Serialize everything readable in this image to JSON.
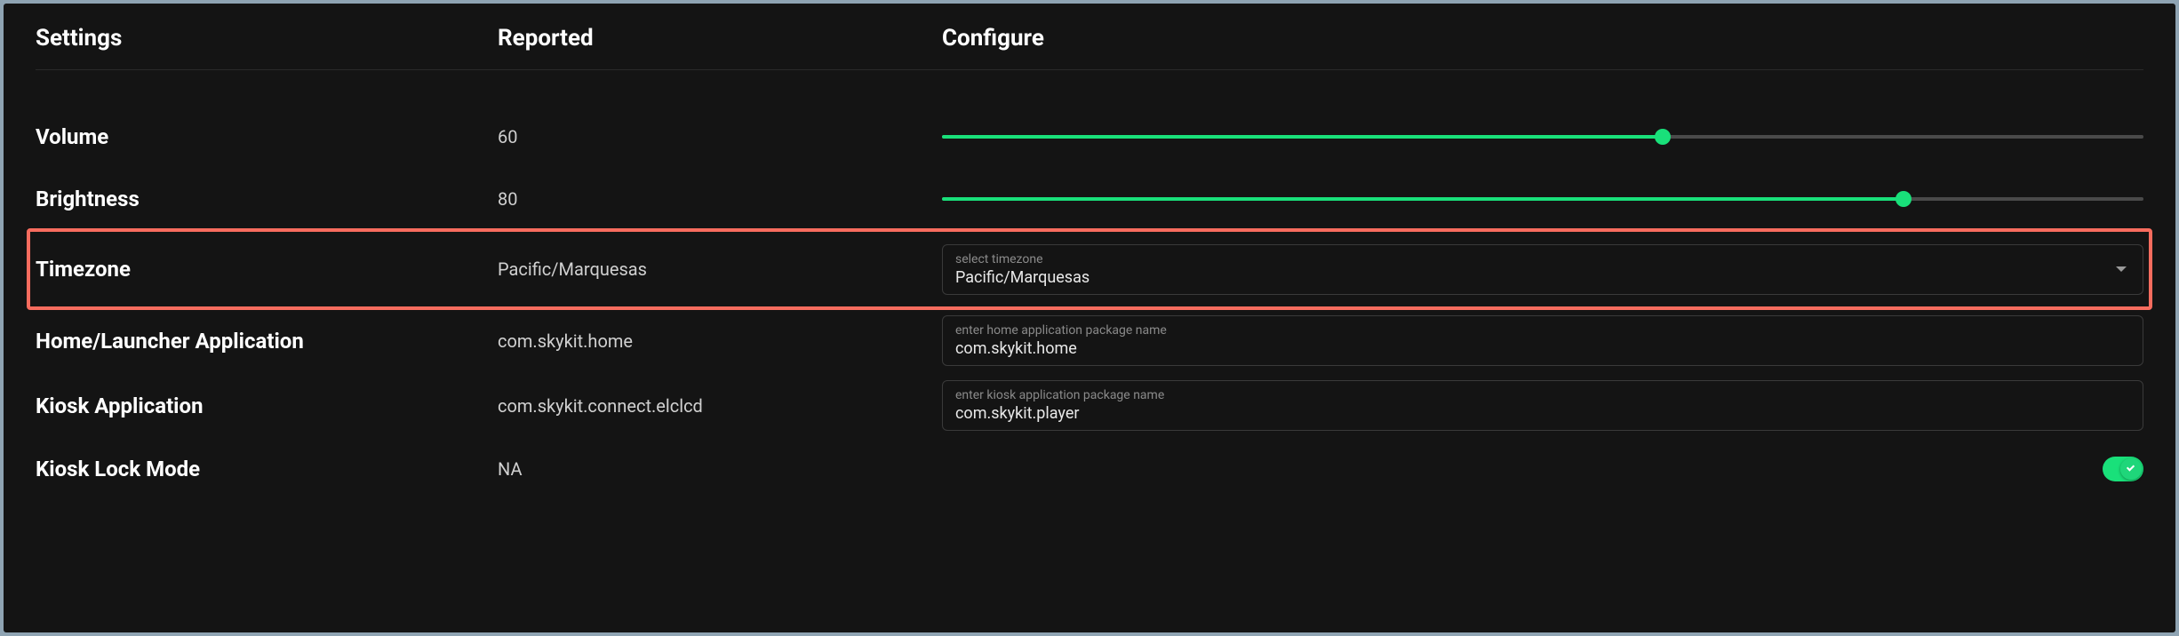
{
  "headers": {
    "settings": "Settings",
    "reported": "Reported",
    "configure": "Configure"
  },
  "volume": {
    "label": "Volume",
    "reported": "60",
    "slider_percent": 60
  },
  "brightness": {
    "label": "Brightness",
    "reported": "80",
    "slider_percent": 80
  },
  "timezone": {
    "label": "Timezone",
    "reported": "Pacific/Marquesas",
    "placeholder": "select timezone",
    "value": "Pacific/Marquesas"
  },
  "home_app": {
    "label": "Home/Launcher Application",
    "reported": "com.skykit.home",
    "placeholder": "enter home application package name",
    "value": "com.skykit.home"
  },
  "kiosk_app": {
    "label": "Kiosk Application",
    "reported": "com.skykit.connect.elclcd",
    "placeholder": "enter kiosk application package name",
    "value": "com.skykit.player"
  },
  "kiosk_lock": {
    "label": "Kiosk Lock Mode",
    "reported": "NA",
    "toggle_on": true
  }
}
